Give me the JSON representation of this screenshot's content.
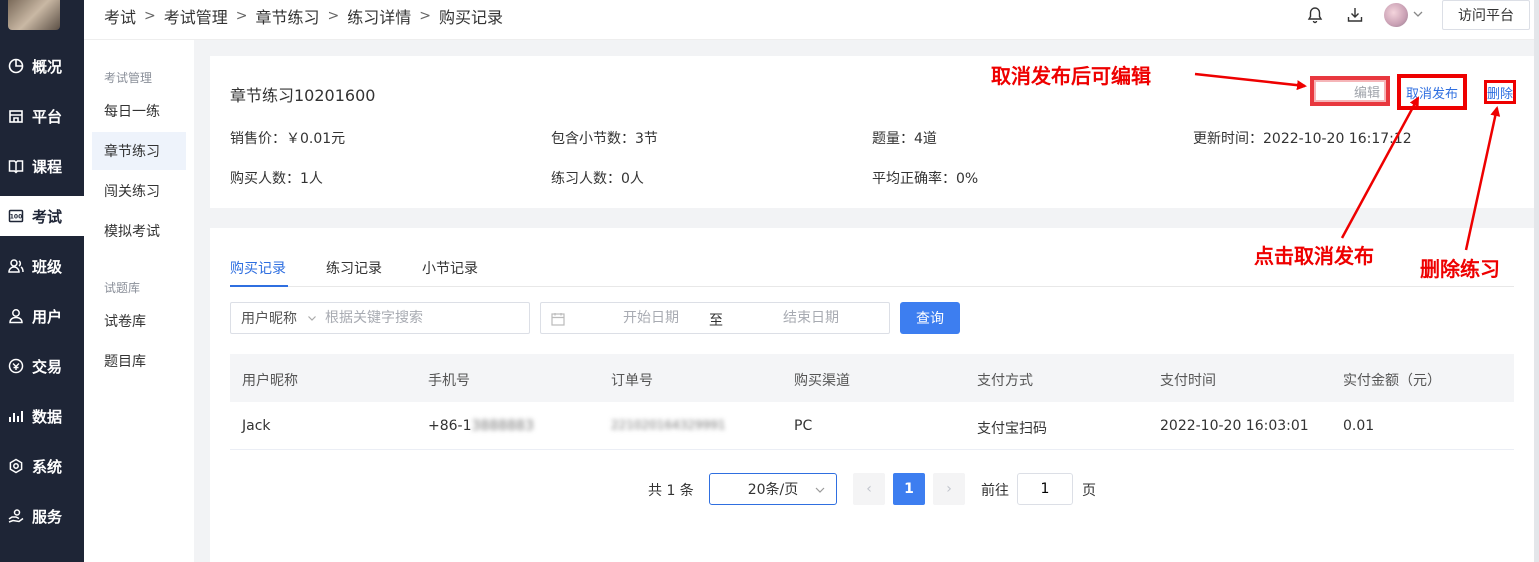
{
  "sidebar": {
    "items": [
      {
        "label": "概况",
        "icon": "pie-chart-icon"
      },
      {
        "label": "平台",
        "icon": "store-icon"
      },
      {
        "label": "课程",
        "icon": "book-icon"
      },
      {
        "label": "考试",
        "icon": "exam-icon",
        "active": true
      },
      {
        "label": "班级",
        "icon": "class-icon"
      },
      {
        "label": "用户",
        "icon": "user-icon"
      },
      {
        "label": "交易",
        "icon": "trade-icon"
      },
      {
        "label": "数据",
        "icon": "bar-chart-icon"
      },
      {
        "label": "系统",
        "icon": "gear-icon"
      },
      {
        "label": "服务",
        "icon": "service-icon"
      }
    ]
  },
  "submenu": {
    "group1": "考试管理",
    "items1": [
      "每日一练",
      "章节练习",
      "闯关练习",
      "模拟考试"
    ],
    "group2": "试题库",
    "items2": [
      "试卷库",
      "题目库"
    ]
  },
  "breadcrumb": [
    "考试",
    "考试管理",
    "章节练习",
    "练习详情",
    "购买记录"
  ],
  "header": {
    "visit_label": "访问平台"
  },
  "info": {
    "title": "章节练习10201600",
    "price": "销售价：￥0.01元",
    "sections": "包含小节数：3节",
    "questions": "题量：4道",
    "updated": "更新时间：2022-10-20 16:17:12",
    "buyers": "购买人数：1人",
    "practitioners": "练习人数：0人",
    "accuracy": "平均正确率：0%",
    "edit_label": "编辑",
    "unpublish_label": "取消发布",
    "delete_label": "删除"
  },
  "tabs": [
    "购买记录",
    "练习记录",
    "小节记录"
  ],
  "filters": {
    "select_value": "用户昵称",
    "search_placeholder": "根据关键字搜索",
    "start_placeholder": "开始日期",
    "range_sep": "至",
    "end_placeholder": "结束日期",
    "query_label": "查询"
  },
  "table": {
    "columns": [
      "用户昵称",
      "手机号",
      "订单号",
      "购买渠道",
      "支付方式",
      "支付时间",
      "实付金额（元）"
    ],
    "rows": [
      {
        "nickname": "Jack",
        "phone": "+86-1",
        "phone_masked": "3888883",
        "order": "221020164329991",
        "channel": "PC",
        "pay_method": "支付宝扫码",
        "pay_time": "2022-10-20 16:03:01",
        "amount": "0.01"
      }
    ]
  },
  "pager": {
    "total": "共 1 条",
    "size": "20条/页",
    "prev": "‹",
    "current": "1",
    "next": "›",
    "goto": "前往",
    "goto_value": "1",
    "suffix": "页"
  },
  "annotations": {
    "edit_note": "取消发布后可编辑",
    "unpublish_note": "点击取消发布",
    "delete_note": "删除练习"
  },
  "colors": {
    "primary": "#3d7ef0",
    "sidebar": "#1e2536",
    "annotation": "#e00000"
  }
}
